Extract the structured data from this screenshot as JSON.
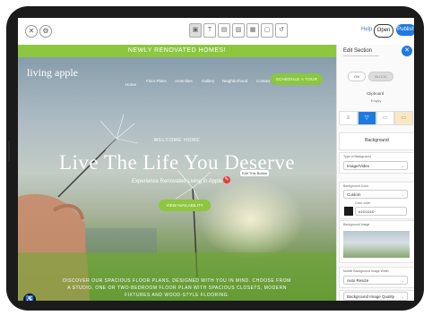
{
  "editor": {
    "toolbar_icons": [
      "select-icon",
      "text-icon",
      "layout-icon",
      "image-icon",
      "grid-icon",
      "page-icon",
      "undo-icon"
    ],
    "help_label": "Help",
    "open_label": "Open",
    "publish_label": "Publish"
  },
  "site": {
    "banner": "NEWLY RENOVATED HOMES!",
    "logo": "living apple",
    "nav": [
      {
        "label": "Home"
      },
      {
        "label": "Floor Plans"
      },
      {
        "label": "Amenities"
      },
      {
        "label": "Gallery"
      },
      {
        "label": "Neighborhood"
      },
      {
        "label": "Contact"
      }
    ],
    "schedule_label": "SCHEDULE A TOUR",
    "welcome": "WELCOME HOME",
    "headline": "Live The Life You Deserve",
    "subtitle": "Experience Renovated Living in Apple",
    "tooltip": "Edit This Button",
    "cta_label": "VIEW AVAILABILITY",
    "description": "DISCOVER OUR SPACIOUS FLOOR PLANS, DESIGNED WITH YOU IN MIND. CHOOSE FROM A STUDIO, ONE OR TWO-BEDROOM FLOOR PLAN WITH SPACIOUS CLOSETS, MODERN FIXTURES AND WOOD-STYLE FLOORING."
  },
  "panel": {
    "title": "Edit Section",
    "toggle_on": "ON",
    "toggle_off": "BLOCK",
    "clipboard_label": "Clipboard",
    "clipboard_sub": "Empty",
    "tabs": [
      "≡",
      "▽",
      "▭",
      "▭"
    ],
    "background_heading": "Background",
    "type_label": "Type of Background",
    "type_value": "Image/Video",
    "color_label": "Background Color",
    "color_value": "Custom",
    "hex_label": "Color code",
    "hex_value": "#1D1D1D",
    "image_label": "Background Image",
    "width_label": "Mobile Background Image Width",
    "width_value": "Auto Resize",
    "quality_label": "Background Image Quality"
  },
  "colors": {
    "accent_green": "#8dc63f",
    "editor_blue": "#1f7ae0"
  }
}
